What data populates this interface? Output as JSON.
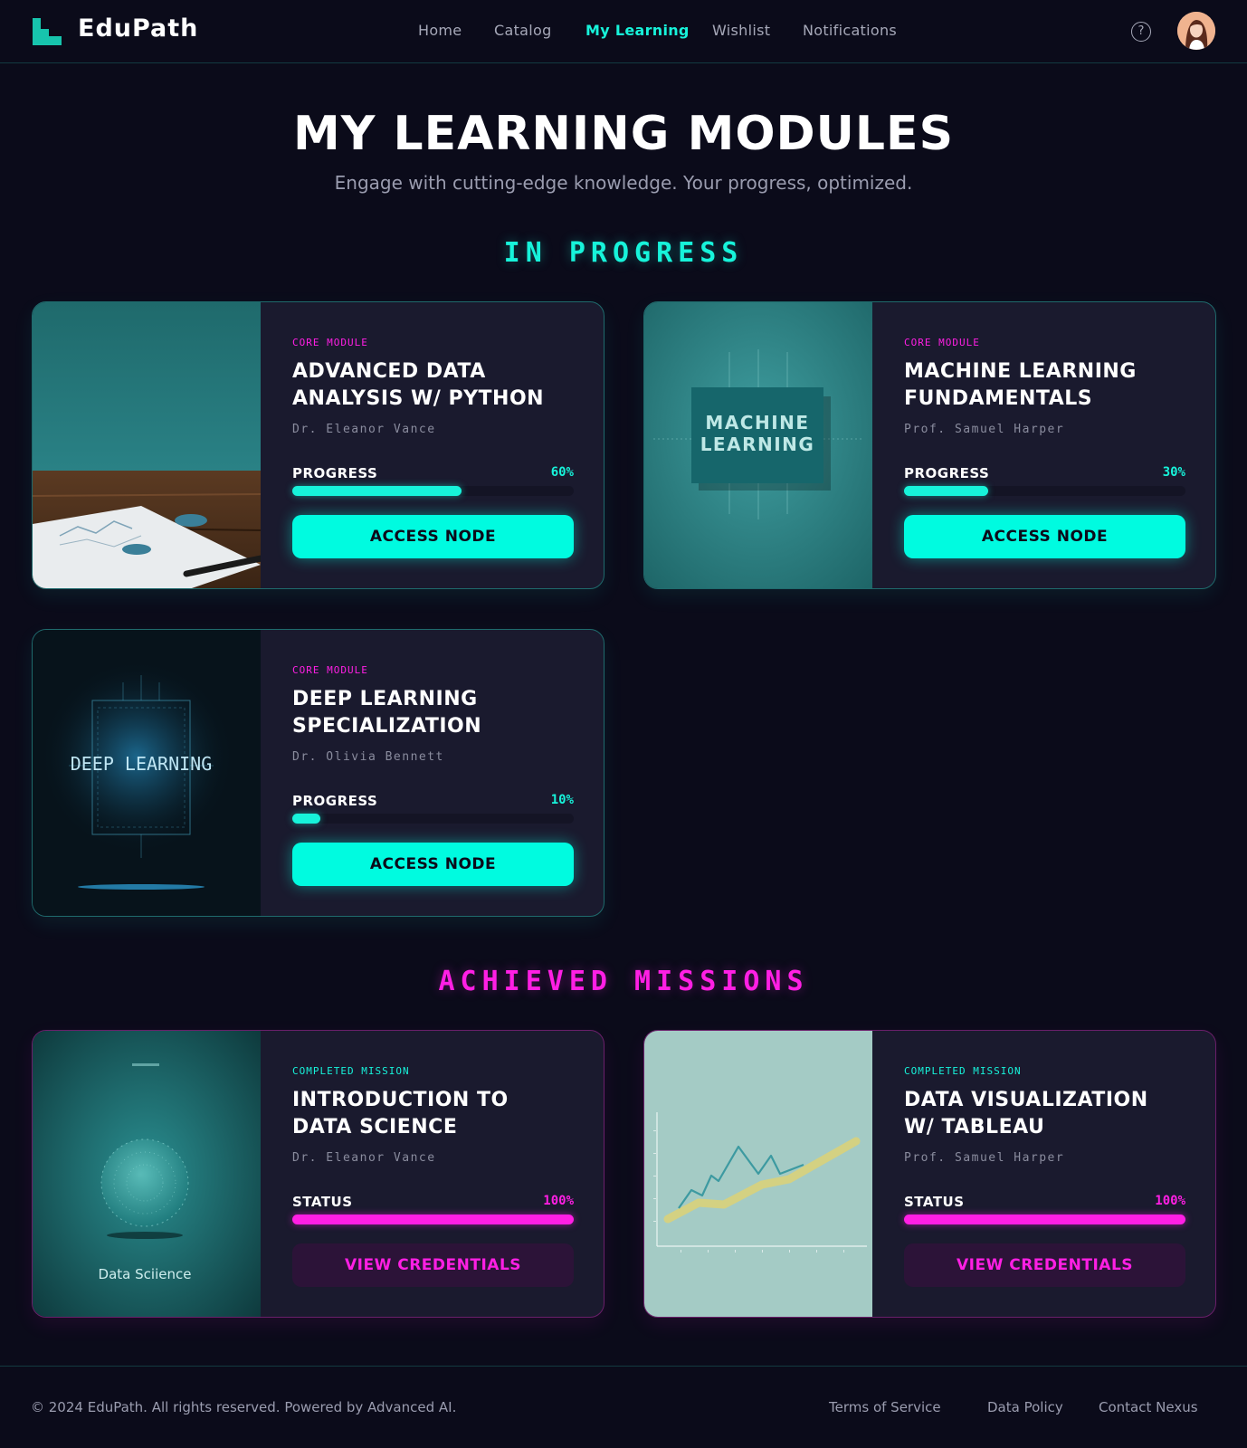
{
  "brand": {
    "name": "EduPath",
    "accent": "#17f3da",
    "secondary_accent": "#ff1fe4",
    "background": "#0b0b1a"
  },
  "nav": {
    "links": [
      {
        "label": "Home",
        "active": false
      },
      {
        "label": "Catalog",
        "active": false
      },
      {
        "label": "My Learning",
        "active": true
      },
      {
        "label": "Wishlist",
        "active": false
      },
      {
        "label": "Notifications",
        "active": false
      }
    ],
    "help_icon": "?",
    "icons": [
      "help-circle-icon",
      "user-avatar"
    ]
  },
  "header": {
    "title": "MY LEARNING MODULES",
    "subtitle": "Engage with cutting-edge knowledge. Your progress, optimized."
  },
  "in_progress": {
    "title": "IN PROGRESS",
    "courses": [
      {
        "eyebrow": "CORE MODULE",
        "title": "ADVANCED DATA ANALYSIS W/ PYTHON",
        "instructor": "Dr. Eleanor Vance",
        "progress_label": "PROGRESS",
        "progress_text": "60%",
        "progress": 0.6,
        "button": "ACCESS NODE"
      },
      {
        "eyebrow": "CORE MODULE",
        "title": "MACHINE LEARNING FUNDAMENTALS",
        "instructor": "Prof. Samuel Harper",
        "progress_label": "PROGRESS",
        "progress_text": "30%",
        "progress": 0.3,
        "button": "ACCESS NODE",
        "thumb_text_1": "MACHINE",
        "thumb_text_2": "LEARNING"
      },
      {
        "eyebrow": "CORE MODULE",
        "title": "DEEP LEARNING SPECIALIZATION",
        "instructor": "Dr. Olivia Bennett",
        "progress_label": "PROGRESS",
        "progress_text": "10%",
        "progress": 0.1,
        "button": "ACCESS NODE",
        "thumb_text": "DEEP LEARNING"
      }
    ]
  },
  "achieved": {
    "title": "ACHIEVED MISSIONS",
    "courses": [
      {
        "eyebrow": "COMPLETED MISSION",
        "title": "INTRODUCTION TO DATA SCIENCE",
        "instructor": "Dr. Eleanor Vance",
        "progress_label": "STATUS",
        "progress_text": "100%",
        "progress": 1.0,
        "button": "VIEW CREDENTIALS",
        "thumb_text": "Data Sciience"
      },
      {
        "eyebrow": "COMPLETED MISSION",
        "title": "DATA VISUALIZATION W/ TABLEAU",
        "instructor": "Prof. Samuel Harper",
        "progress_label": "STATUS",
        "progress_text": "100%",
        "progress": 1.0,
        "button": "VIEW CREDENTIALS"
      }
    ]
  },
  "footer": {
    "copyright": "© 2024 EduPath. All rights reserved. Powered by Advanced AI.",
    "links": [
      "Terms of Service",
      "Data Policy",
      "Contact Nexus"
    ]
  }
}
